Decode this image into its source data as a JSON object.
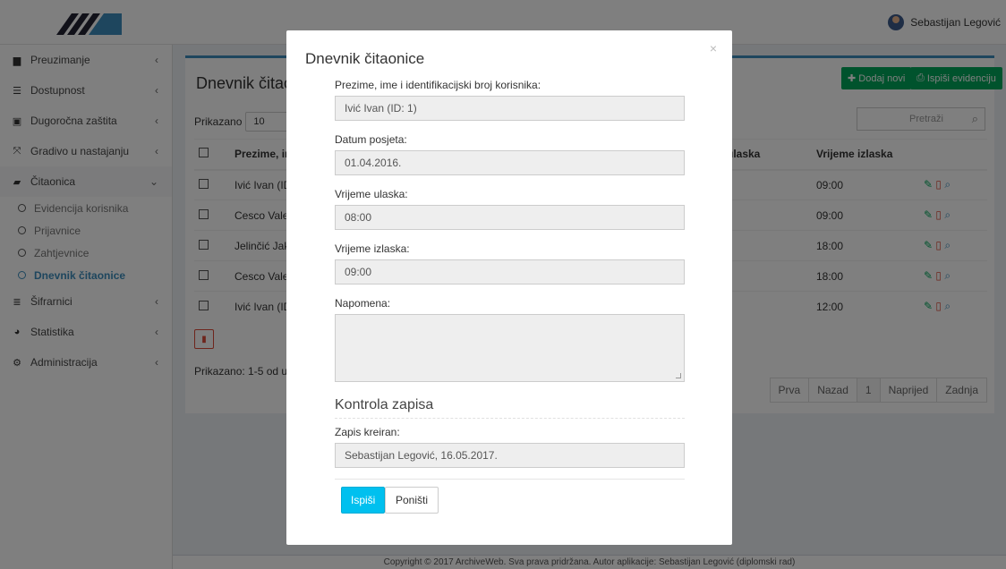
{
  "colors": {
    "primary": "#3c8dbc",
    "success": "#00a65a",
    "danger": "#dd4b39",
    "info": "#00c0ef"
  },
  "header": {
    "user_name": "Sebastijan Legović",
    "logo_icon": "archive-logo-icon",
    "avatar_icon": "user-avatar-icon"
  },
  "sidebar": {
    "items": [
      {
        "label": "Preuzimanje",
        "icon": "download-icon"
      },
      {
        "label": "Dostupnost",
        "icon": "list-icon"
      },
      {
        "label": "Dugoročna zaštita",
        "icon": "shield-icon"
      },
      {
        "label": "Gradivo u nastajanju",
        "icon": "expand-icon"
      },
      {
        "label": "Čitaonica",
        "icon": "book-icon"
      }
    ],
    "subitems": [
      {
        "label": "Evidencija korisnika"
      },
      {
        "label": "Prijavnice"
      },
      {
        "label": "Zahtjevnice"
      },
      {
        "label": "Dnevnik čitaonice"
      }
    ],
    "items2": [
      {
        "label": "Šifrarnici",
        "icon": "database-icon"
      },
      {
        "label": "Statistika",
        "icon": "pie-chart-icon"
      },
      {
        "label": "Administracija",
        "icon": "cogs-icon"
      }
    ]
  },
  "main": {
    "title": "Dnevnik čitao",
    "add_button": "Dodaj novi",
    "print_button": "Ispiši evidenciju",
    "length_label": "Prikazano",
    "length_value": "10",
    "search_placeholder": "Pretraži",
    "columns": [
      "Prezime, im",
      "ulaska",
      "Vrijeme izlaska"
    ],
    "rows": [
      {
        "name": "Ivić Ivan (ID",
        "out": "09:00"
      },
      {
        "name": "Cesco Valer",
        "out": "09:00"
      },
      {
        "name": "Jelinčić Jak",
        "out": "18:00"
      },
      {
        "name": "Cesco Valer",
        "out": "18:00"
      },
      {
        "name": "Ivić Ivan (ID",
        "out": "12:00"
      }
    ],
    "info": "Prikazano: 1-5 od uku",
    "pagination": [
      "Prva",
      "Nazad",
      "1",
      "Naprijed",
      "Zadnja"
    ]
  },
  "footer": {
    "text": "Copyright © 2017 ArchiveWeb. Sva prava pridržana. Autor aplikacije: Sebastijan Legović (diplomski rad)"
  },
  "modal": {
    "title": "Dnevnik čitaonice",
    "close": "×",
    "fields": {
      "user_label": "Prezime, ime i identifikacijski broj korisnika:",
      "user_value": "Ivić Ivan (ID: 1)",
      "date_label": "Datum posjeta:",
      "date_value": "01.04.2016.",
      "in_label": "Vrijeme ulaska:",
      "in_value": "08:00",
      "out_label": "Vrijeme izlaska:",
      "out_value": "09:00",
      "note_label": "Napomena:",
      "note_value": ""
    },
    "section_title": "Kontrola zapisa",
    "created_label": "Zapis kreiran:",
    "created_value": "Sebastijan Legović, 16.05.2017.",
    "print_btn": "Ispiši",
    "cancel_btn": "Poništi"
  }
}
